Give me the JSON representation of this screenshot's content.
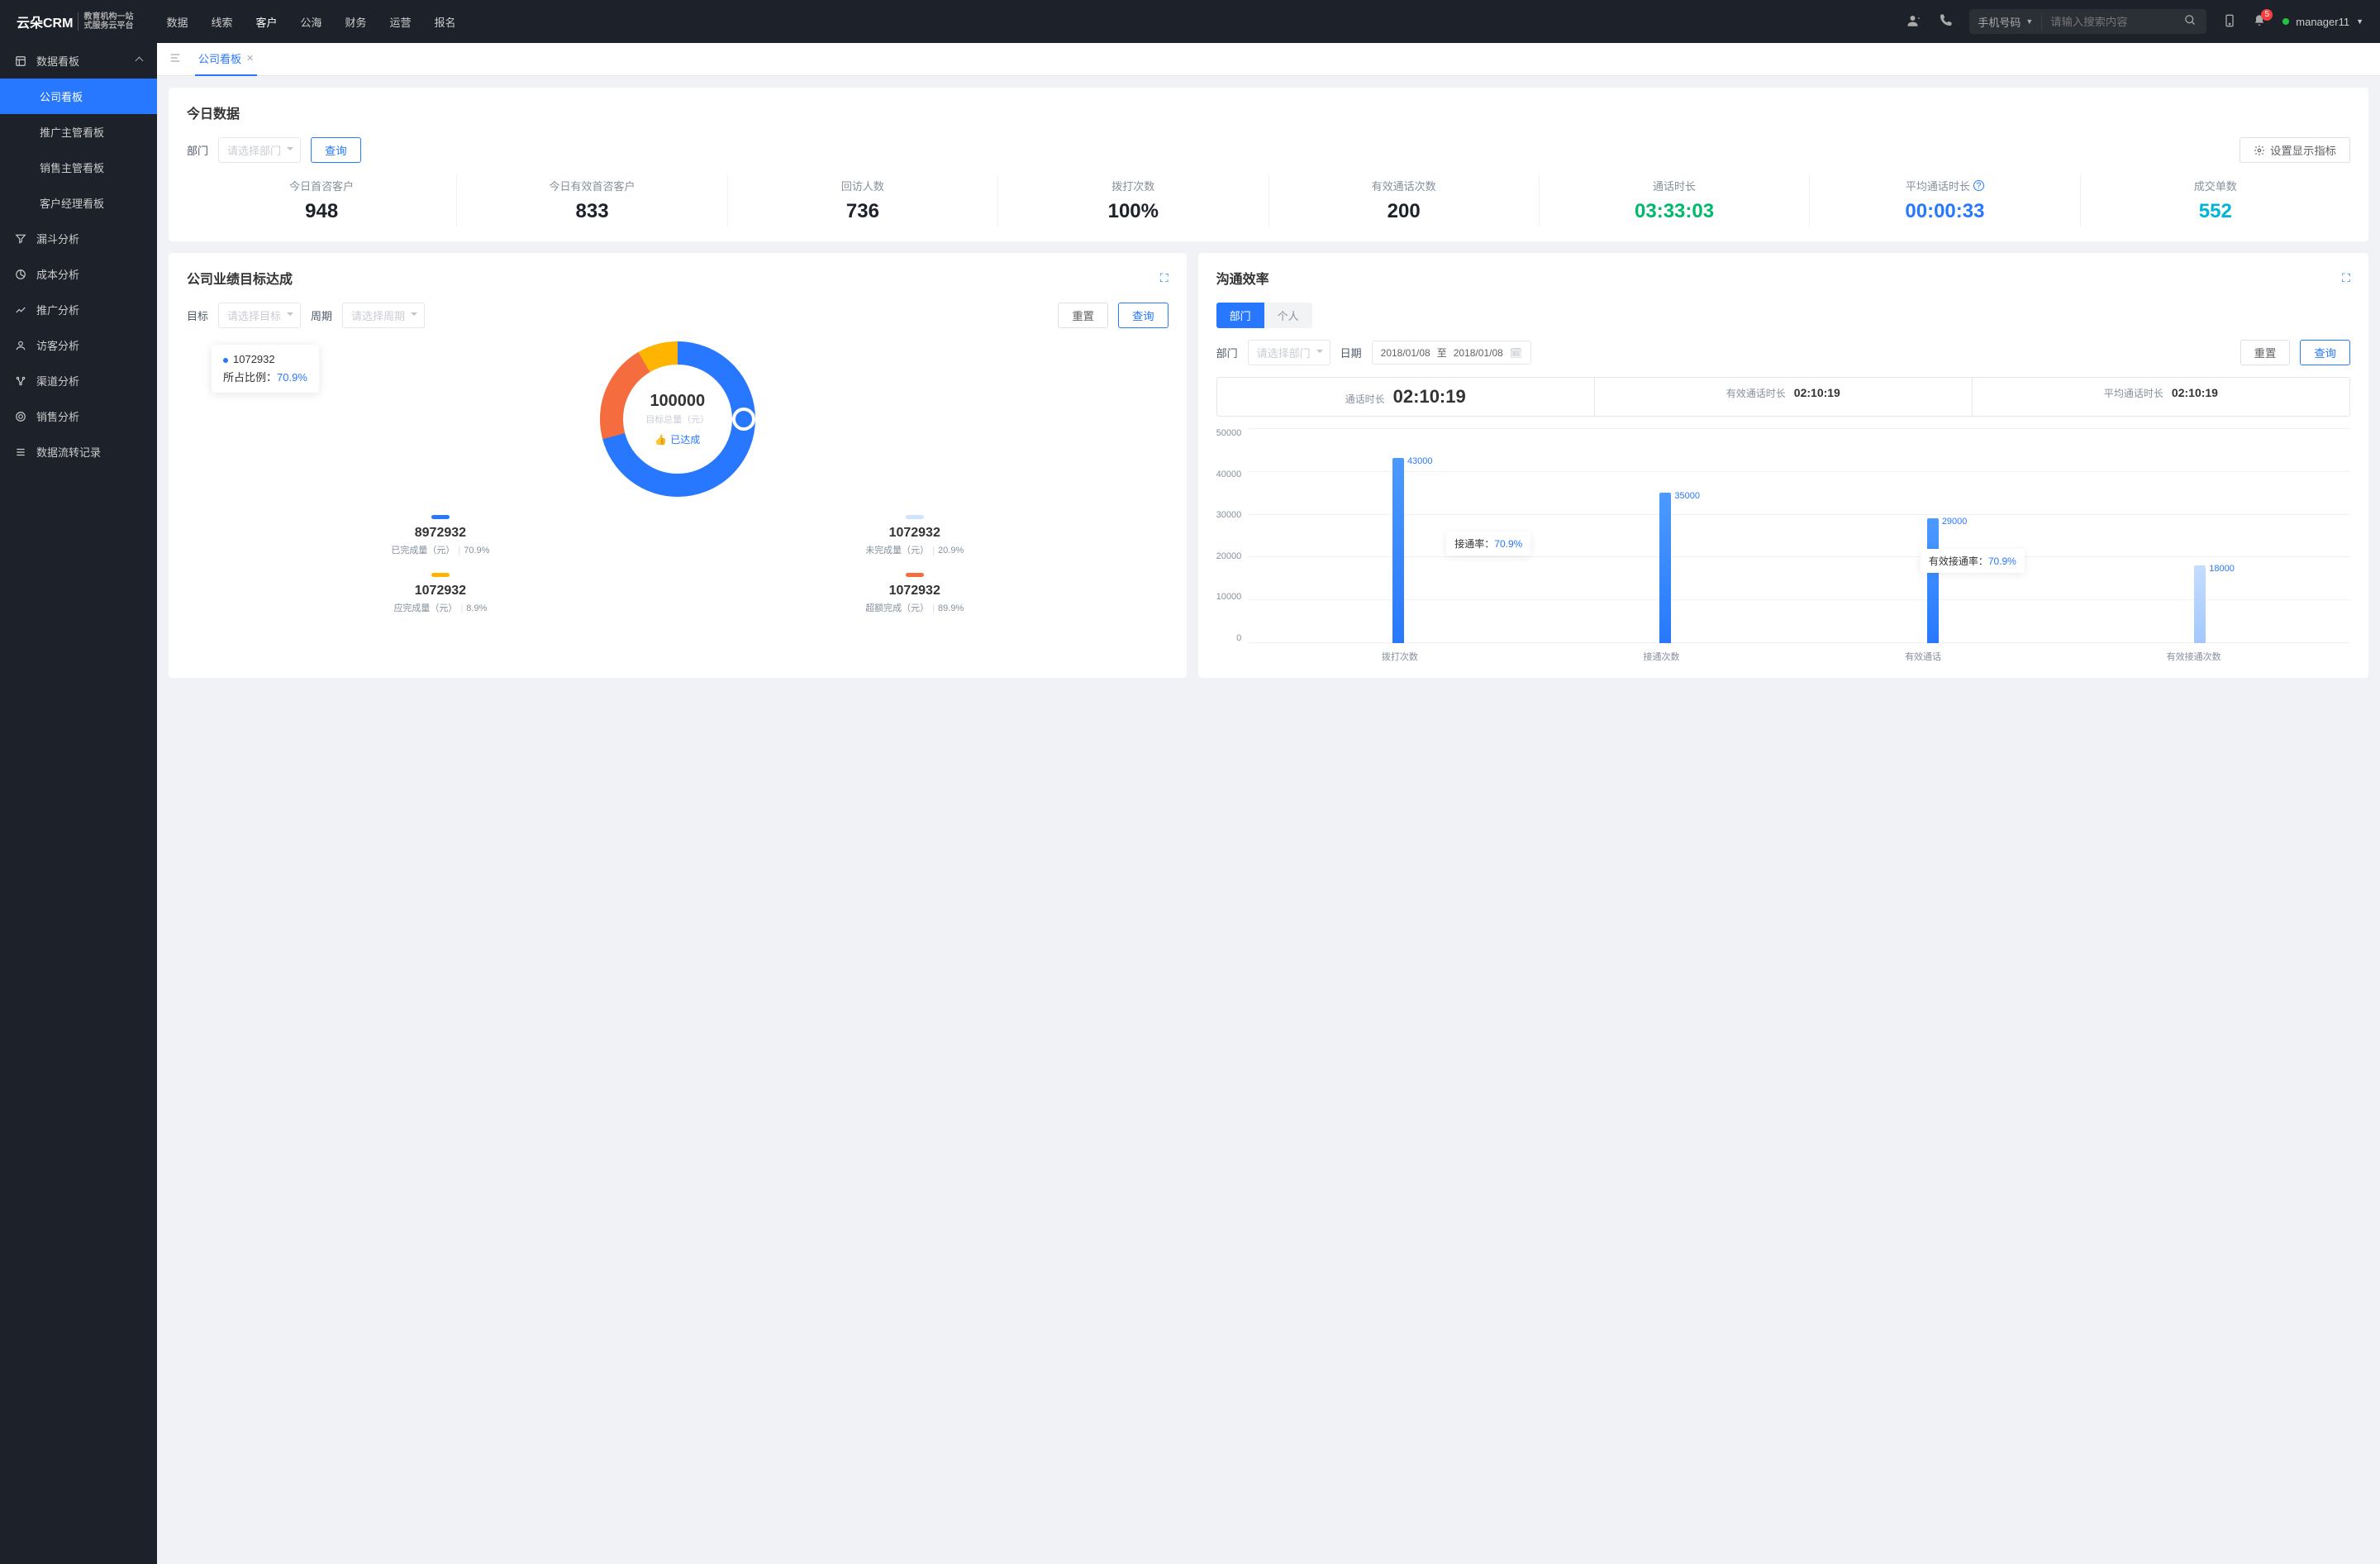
{
  "header": {
    "logo_main": "云朵CRM",
    "logo_url": "www.yunduocrm.com",
    "logo_sub1": "教育机构一站",
    "logo_sub2": "式服务云平台",
    "nav": [
      "数据",
      "线索",
      "客户",
      "公海",
      "财务",
      "运营",
      "报名"
    ],
    "nav_active": 2,
    "search_type": "手机号码",
    "search_placeholder": "请输入搜索内容",
    "notif_count": "5",
    "user_name": "manager11"
  },
  "sidebar": {
    "group_title": "数据看板",
    "subs": [
      "公司看板",
      "推广主管看板",
      "销售主管看板",
      "客户经理看板"
    ],
    "active_sub": 0,
    "items": [
      "漏斗分析",
      "成本分析",
      "推广分析",
      "访客分析",
      "渠道分析",
      "销售分析",
      "数据流转记录"
    ]
  },
  "tab": {
    "label": "公司看板"
  },
  "today": {
    "title": "今日数据",
    "dept_label": "部门",
    "dept_placeholder": "请选择部门",
    "query_btn": "查询",
    "settings_btn": "设置显示指标",
    "stats": [
      {
        "label": "今日首咨客户",
        "value": "948",
        "color": "#1d2129"
      },
      {
        "label": "今日有效首咨客户",
        "value": "833",
        "color": "#1d2129"
      },
      {
        "label": "回访人数",
        "value": "736",
        "color": "#1d2129"
      },
      {
        "label": "拨打次数",
        "value": "100%",
        "color": "#1d2129"
      },
      {
        "label": "有效通话次数",
        "value": "200",
        "color": "#1d2129"
      },
      {
        "label": "通话时长",
        "value": "03:33:03",
        "color": "#00b96b"
      },
      {
        "label": "平均通话时长",
        "value": "00:00:33",
        "color": "#2878ff",
        "info": true
      },
      {
        "label": "成交单数",
        "value": "552",
        "color": "#00b4d8"
      }
    ]
  },
  "goal": {
    "title": "公司业绩目标达成",
    "target_label": "目标",
    "target_placeholder": "请选择目标",
    "period_label": "周期",
    "period_placeholder": "请选择周期",
    "reset_btn": "重置",
    "query_btn": "查询",
    "center_value": "100000",
    "center_sub": "目标总量（元）",
    "achieved_label": "已达成",
    "tooltip_value": "1072932",
    "tooltip_pct_label": "所占比例：",
    "tooltip_pct": "70.9%",
    "legends": [
      {
        "color": "#2878ff",
        "value": "8972932",
        "label": "已完成量（元）",
        "pct": "70.9%"
      },
      {
        "color": "#d0e4ff",
        "value": "1072932",
        "label": "未完成量（元）",
        "pct": "20.9%"
      },
      {
        "color": "#ffb400",
        "value": "1072932",
        "label": "应完成量（元）",
        "pct": "8.9%"
      },
      {
        "color": "#f56c3f",
        "value": "1072932",
        "label": "超额完成（元）",
        "pct": "89.9%"
      }
    ]
  },
  "comm": {
    "title": "沟通效率",
    "seg_dept": "部门",
    "seg_person": "个人",
    "dept_label": "部门",
    "dept_placeholder": "请选择部门",
    "date_label": "日期",
    "date_from": "2018/01/08",
    "date_to_label": "至",
    "date_to": "2018/01/08",
    "reset_btn": "重置",
    "query_btn": "查询",
    "durations": [
      {
        "label": "通话时长",
        "value": "02:10:19"
      },
      {
        "label": "有效通话时长",
        "value": "02:10:19"
      },
      {
        "label": "平均通话时长",
        "value": "02:10:19"
      }
    ],
    "ann1_label": "接通率：",
    "ann1_pct": "70.9%",
    "ann2_label": "有效接通率：",
    "ann2_pct": "70.9%"
  },
  "chart_data": {
    "type": "bar",
    "categories": [
      "拨打次数",
      "接通次数",
      "有效通话",
      "有效接通次数"
    ],
    "values": [
      43000,
      35000,
      29000,
      18000
    ],
    "value_labels": [
      "43000",
      "35000",
      "29000",
      "18000"
    ],
    "ylim": [
      0,
      50000
    ],
    "y_ticks": [
      0,
      10000,
      20000,
      30000,
      40000,
      50000
    ],
    "annotations": [
      {
        "text": "接通率：70.9%",
        "after_index": 0
      },
      {
        "text": "有效接通率：70.9%",
        "after_index": 2
      }
    ]
  }
}
